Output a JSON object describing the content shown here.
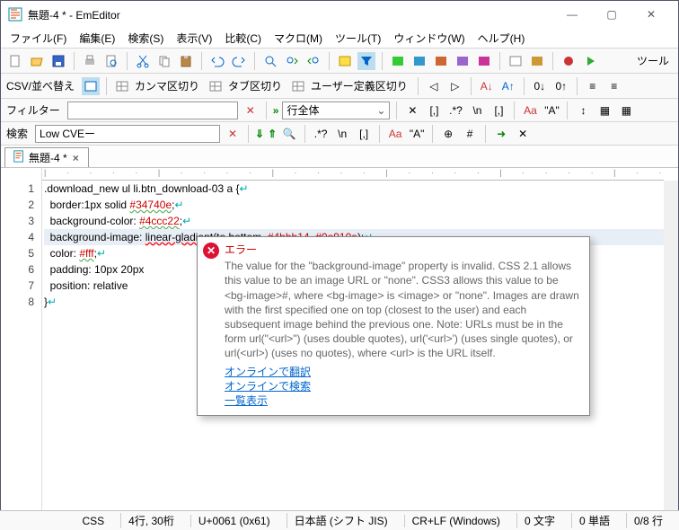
{
  "window": {
    "title": "無題-4 * - EmEditor"
  },
  "menu": [
    "ファイル(F)",
    "編集(E)",
    "検索(S)",
    "表示(V)",
    "比較(C)",
    "マクロ(M)",
    "ツール(T)",
    "ウィンドウ(W)",
    "ヘルプ(H)"
  ],
  "toolbar2": {
    "csv_sort": "CSV/並べ替え",
    "comma": "カンマ区切り",
    "tab": "タブ区切り",
    "user": "ユーザー定義区切り"
  },
  "filter": {
    "label": "フィルター",
    "value": "",
    "scope": "行全体"
  },
  "search": {
    "label": "検索",
    "value": "Low CVEー"
  },
  "tab": {
    "label": "無題-4 *"
  },
  "ruler": "| · · · · | · · · · | · · · · | · · · · | · · · · | · · · · | · · · · |",
  "code": {
    "l1": ".download_new ul li.btn_download-03 a {",
    "l2a": "  border:",
    "l2b": "1px solid ",
    "l2c": "#34740e",
    "l2d": ";",
    "l3a": "  background-color: ",
    "l3c": "#4ccc22",
    "l3d": ";",
    "l4a": "  background-image: ",
    "l4b": "linear-gladient",
    "l4c": "(to bottom, ",
    "l4d": "#4bbb14",
    "l4e": ", ",
    "l4f": "#0a910a",
    "l4g": ");",
    "l5a": "  color: ",
    "l5c": "#fff",
    "l5d": ";",
    "l6a": "  padding: ",
    "l6b": "10px 20px",
    "l7a": "  position: ",
    "l7b": "relative",
    "l8": "}",
    "nl": "↵"
  },
  "lines": [
    "1",
    "2",
    "3",
    "4",
    "5",
    "6",
    "7",
    "8"
  ],
  "tooltip": {
    "title": "エラー",
    "body": "The value for the \"background-image\" property is invalid. CSS 2.1 allows this value to be an image URL or \"none\". CSS3 allows this value to be <bg-image>#, where <bg-image> is <image> or \"none\". Images are drawn with the first specified one on top (closest to the user) and each subsequent image behind the previous one. Note: URLs must be in the form url(\"<url>\") (uses double quotes), url('<url>') (uses single quotes), or url(<url>) (uses no quotes), where <url> is the URL itself.",
    "links": [
      "オンラインで翻訳",
      "オンラインで検索",
      "一覧表示"
    ]
  },
  "status": {
    "lang": "CSS",
    "pos": "4行, 30桁",
    "code": "U+0061 (0x61)",
    "enc": "日本語 (シフト JIS)",
    "eol": "CR+LF (Windows)",
    "chars": "0 文字",
    "words": "0 単語",
    "lines": "0/8 行"
  },
  "side": "ツール"
}
